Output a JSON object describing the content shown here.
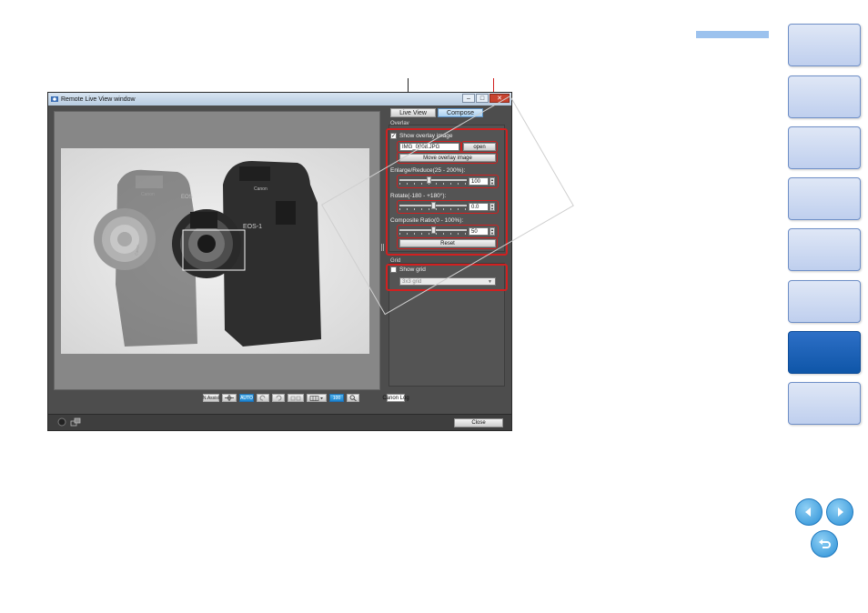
{
  "window": {
    "title": "Remote Live View window",
    "minimize": "–",
    "maximize": "□",
    "close": "✕",
    "close_button": "Close"
  },
  "tabs": [
    "Live View",
    "Compose"
  ],
  "overlay": {
    "group_label": "Overlay",
    "show_overlay_label": "Show overlay image",
    "show_overlay_checked": "✓",
    "filename": "IMG_0008.JPG",
    "open_label": "open",
    "move_label": "Move overlay image",
    "enlarge_label": "Enlarge/Reduce(25 - 200%):",
    "enlarge_value": "100",
    "enlarge_fraction": 0.43,
    "rotate_label": "Rotate(-180 - +180°):",
    "rotate_value": "0.0",
    "rotate_fraction": 0.5,
    "composite_label": "Composite Ratio(0 - 100%):",
    "composite_value": "50",
    "composite_fraction": 0.5,
    "reset_label": "Reset"
  },
  "grid": {
    "group_label": "Grid",
    "show_grid_label": "Show grid",
    "grid_select": "3x3 grid"
  },
  "toolbar": {
    "assist_label": "N.Assist",
    "auto_label": "AUTO",
    "zoom_label": "100",
    "canon_log_label": "Canon Log"
  },
  "photo": {
    "brand_left": "Canon",
    "brand_right": "Canon",
    "model_left": "EOS",
    "model_right": "EOS-1",
    "lens_text": "Canon"
  },
  "colors": {
    "accent_red": "#d12020",
    "nav_active": "#1262b3",
    "nav_idle": "#c9d7f1"
  }
}
